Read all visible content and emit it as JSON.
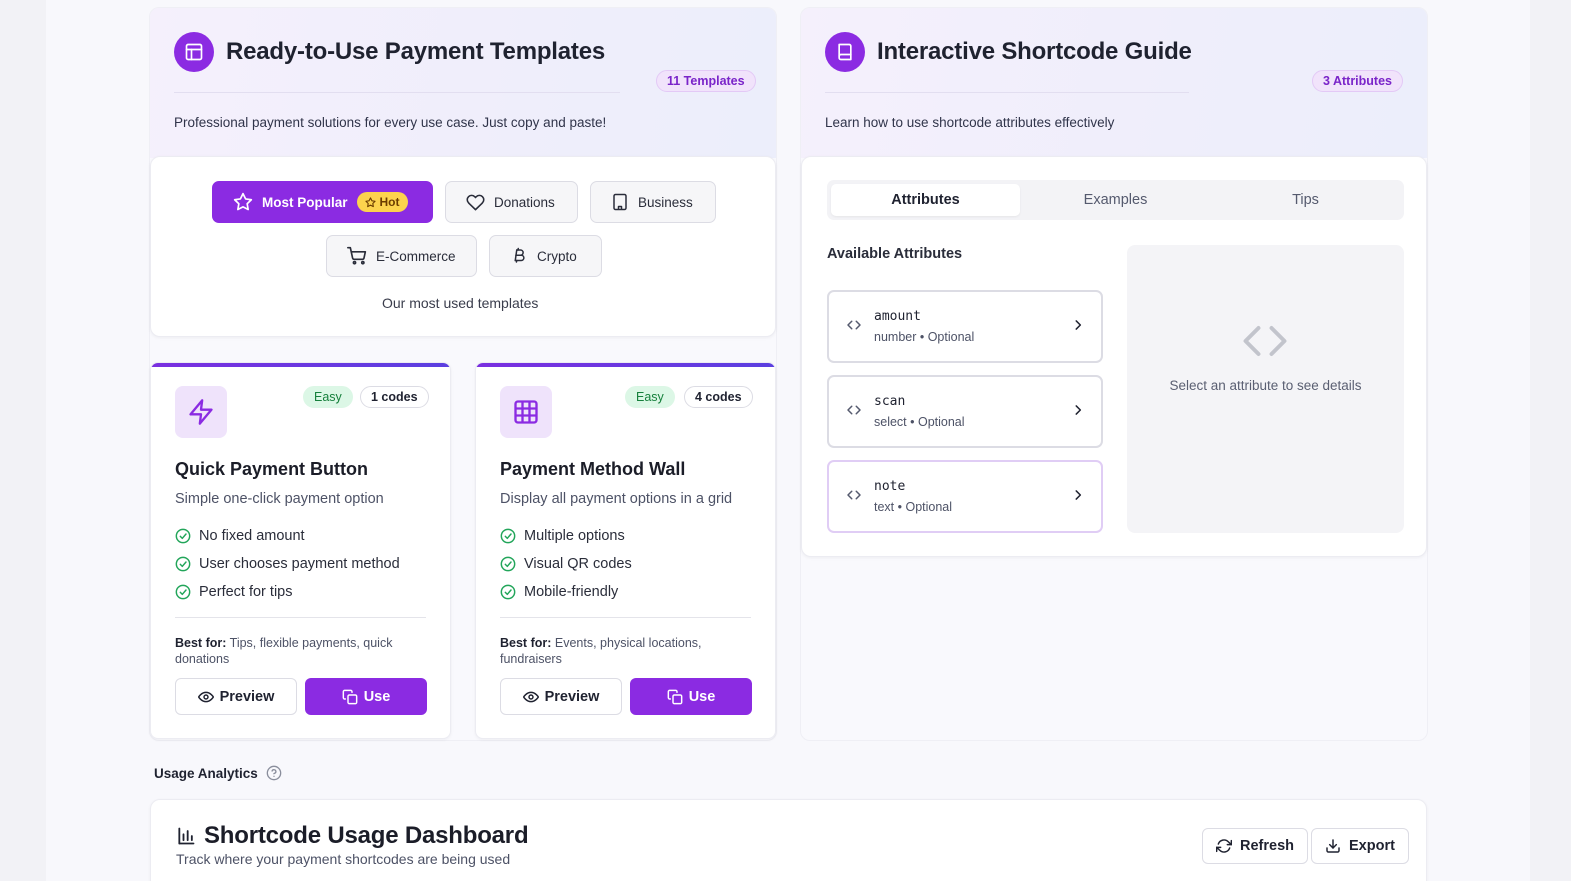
{
  "templates_panel": {
    "title": "Ready-to-Use Payment Templates",
    "count_badge": "11 Templates",
    "description": "Professional payment solutions for every use case. Just copy and paste!",
    "icon": "layout-icon",
    "filters": [
      {
        "label": "Most Popular",
        "icon": "star-icon",
        "badge": "Hot",
        "active": true
      },
      {
        "label": "Donations",
        "icon": "heart-icon"
      },
      {
        "label": "Business",
        "icon": "building-icon"
      },
      {
        "label": "E-Commerce",
        "icon": "cart-icon"
      },
      {
        "label": "Crypto",
        "icon": "bitcoin-icon"
      }
    ],
    "filter_caption": "Our most used templates",
    "cards": [
      {
        "icon": "zap-icon",
        "difficulty": "Easy",
        "codes": "1 codes",
        "title": "Quick Payment Button",
        "subtitle": "Simple one-click payment option",
        "features": [
          "No fixed amount",
          "User chooses payment method",
          "Perfect for tips"
        ],
        "best_for_label": "Best for:",
        "best_for": "Tips, flexible payments, quick donations",
        "preview_label": "Preview",
        "use_label": "Use"
      },
      {
        "icon": "grid-icon",
        "difficulty": "Easy",
        "codes": "4 codes",
        "title": "Payment Method Wall",
        "subtitle": "Display all payment options in a grid",
        "features": [
          "Multiple options",
          "Visual QR codes",
          "Mobile-friendly"
        ],
        "best_for_label": "Best for:",
        "best_for": "Events, physical locations, fundraisers",
        "preview_label": "Preview",
        "use_label": "Use"
      }
    ]
  },
  "guide_panel": {
    "title": "Interactive Shortcode Guide",
    "count_badge": "3 Attributes",
    "description": "Learn how to use shortcode attributes effectively",
    "icon": "book-icon",
    "tabs": [
      {
        "label": "Attributes",
        "active": true
      },
      {
        "label": "Examples"
      },
      {
        "label": "Tips"
      }
    ],
    "available_label": "Available Attributes",
    "attributes": [
      {
        "name": "amount",
        "meta": "number • Optional"
      },
      {
        "name": "scan",
        "meta": "select • Optional"
      },
      {
        "name": "note",
        "meta": "text • Optional"
      }
    ],
    "detail_placeholder": "Select an attribute to see details"
  },
  "analytics": {
    "label": "Usage Analytics",
    "dashboard_title": "Shortcode Usage Dashboard",
    "dashboard_subtitle": "Track where your payment shortcodes are being used",
    "refresh_label": "Refresh",
    "export_label": "Export"
  },
  "colors": {
    "accent": "#8b2be2",
    "success": "#22a55a",
    "hot": "#fcd34d"
  }
}
